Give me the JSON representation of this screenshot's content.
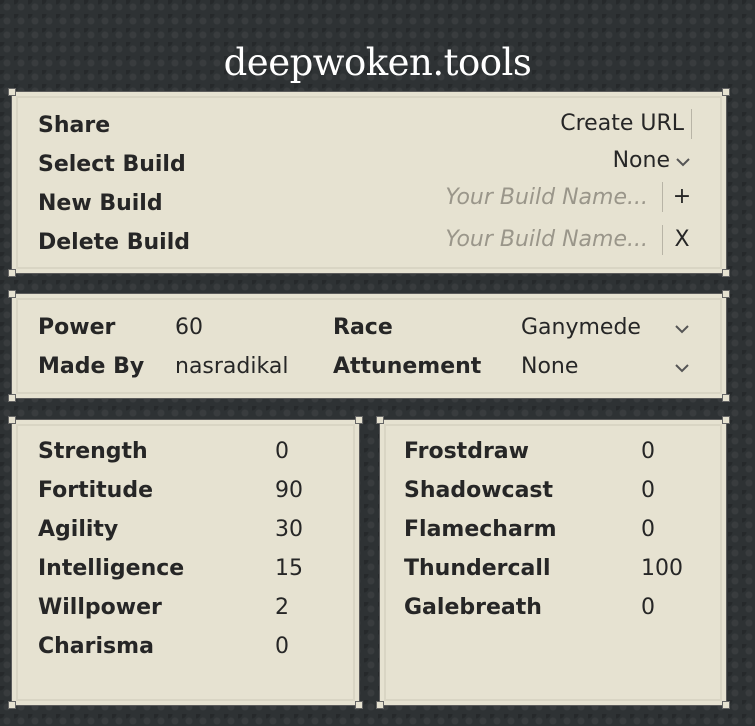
{
  "header": {
    "title": "deepwoken.tools"
  },
  "build_panel": {
    "share_label": "Share",
    "create_url_label": "Create URL",
    "select_build_label": "Select Build",
    "select_build_value": "None",
    "new_build_label": "New Build",
    "new_build_placeholder": "Your Build Name...",
    "add_button": "+",
    "delete_build_label": "Delete Build",
    "delete_build_placeholder": "Your Build Name...",
    "delete_button": "X"
  },
  "info_panel": {
    "power_label": "Power",
    "power_value": "60",
    "race_label": "Race",
    "race_value": "Ganymede",
    "made_by_label": "Made By",
    "made_by_value": "nasradikal",
    "attunement_label": "Attunement",
    "attunement_value": "None"
  },
  "stats_panel": {
    "rows": [
      {
        "label": "Strength",
        "value": "0"
      },
      {
        "label": "Fortitude",
        "value": "90"
      },
      {
        "label": "Agility",
        "value": "30"
      },
      {
        "label": "Intelligence",
        "value": "15"
      },
      {
        "label": "Willpower",
        "value": "2"
      },
      {
        "label": "Charisma",
        "value": "0"
      }
    ]
  },
  "attunement_panel": {
    "rows": [
      {
        "label": "Frostdraw",
        "value": "0"
      },
      {
        "label": "Shadowcast",
        "value": "0"
      },
      {
        "label": "Flamecharm",
        "value": "0"
      },
      {
        "label": "Thundercall",
        "value": "100"
      },
      {
        "label": "Galebreath",
        "value": "0"
      }
    ]
  },
  "icons": {
    "dropdown": "chevron-down-icon"
  }
}
